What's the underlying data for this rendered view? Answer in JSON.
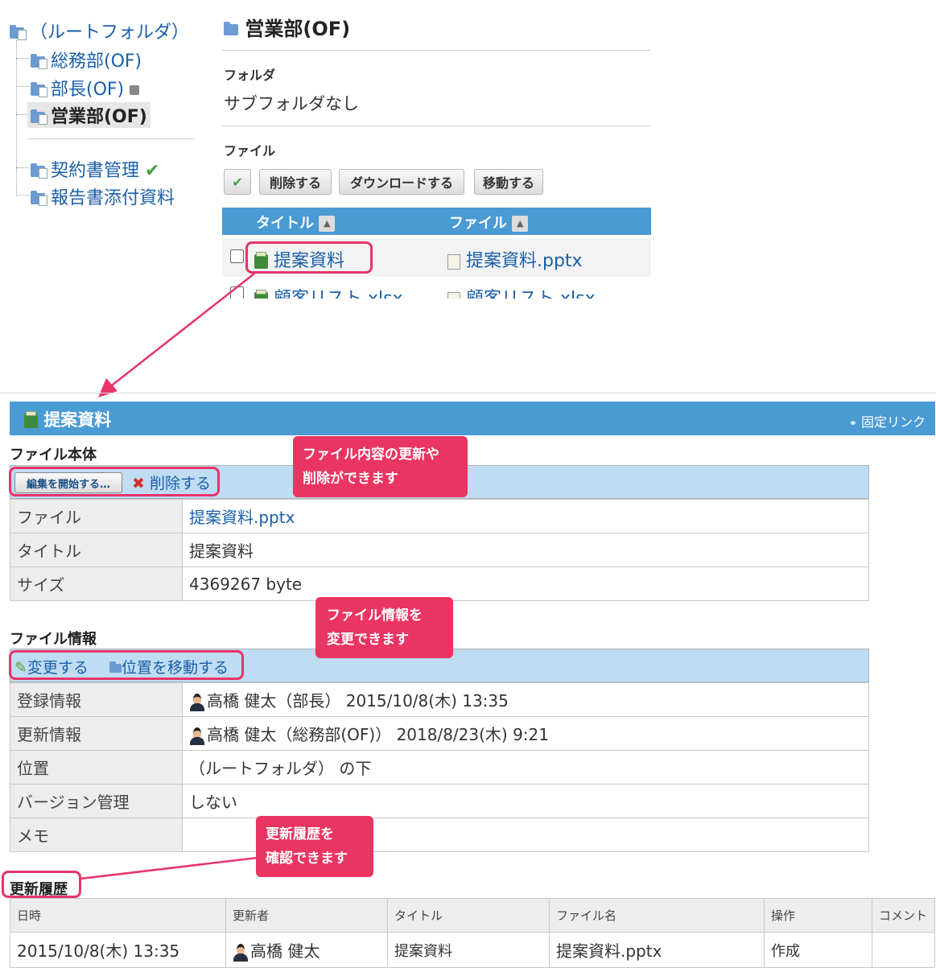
{
  "tree": {
    "root": "（ルートフォルダ）",
    "items": [
      {
        "label": "総務部(OF)"
      },
      {
        "label": "部長(OF)"
      },
      {
        "label": "営業部(OF)"
      },
      {
        "label": "契約書管理"
      },
      {
        "label": "報告書添付資料"
      }
    ]
  },
  "folder": {
    "title": "営業部(OF)",
    "subfolders_heading": "フォルダ",
    "subfolders_text": "サブフォルダなし",
    "files_heading": "ファイル",
    "buttons": {
      "check": "✔",
      "delete": "削除する",
      "download": "ダウンロードする",
      "move": "移動する"
    },
    "columns": {
      "title": "タイトル",
      "file": "ファイル"
    },
    "rows": [
      {
        "title": "提案資料",
        "file": "提案資料.pptx"
      },
      {
        "title": "顧客リスト.xlsx",
        "file": "顧客リスト.xlsx"
      }
    ]
  },
  "detail": {
    "title": "提案資料",
    "permalink": "固定リンク",
    "body_heading": "ファイル本体",
    "edit_button": "編集を開始する…",
    "delete_link": "削除する",
    "body_rows": [
      {
        "k": "ファイル",
        "v": "提案資料.pptx"
      },
      {
        "k": "タイトル",
        "v": "提案資料"
      },
      {
        "k": "サイズ",
        "v": "4369267 byte"
      }
    ],
    "info_heading": "ファイル情報",
    "change_link": "変更する",
    "move_link": "位置を移動する",
    "info_rows": [
      {
        "k": "登録情報",
        "v": "高橋 健太（部長） 2015/10/8(木) 13:35"
      },
      {
        "k": "更新情報",
        "v": "高橋 健太（総務部(OF)） 2018/8/23(木) 9:21"
      },
      {
        "k": "位置",
        "v": "（ルートフォルダ） の下"
      },
      {
        "k": "バージョン管理",
        "v": "しない"
      },
      {
        "k": "メモ",
        "v": ""
      }
    ],
    "history_heading": "更新履歴",
    "history_cols": [
      "日時",
      "更新者",
      "タイトル",
      "ファイル名",
      "操作",
      "コメント"
    ],
    "history_rows": [
      {
        "date": "2015/10/8(木) 13:35",
        "user": "高橋 健太",
        "title": "提案資料",
        "file": "提案資料.pptx",
        "op": "作成",
        "comment": ""
      }
    ]
  },
  "callouts": {
    "c1_line1": "ファイル内容の更新や",
    "c1_line2": "削除ができます",
    "c2_line1": "ファイル情報を",
    "c2_line2": "変更できます",
    "c3_line1": "更新履歴を",
    "c3_line2": "確認できます"
  }
}
